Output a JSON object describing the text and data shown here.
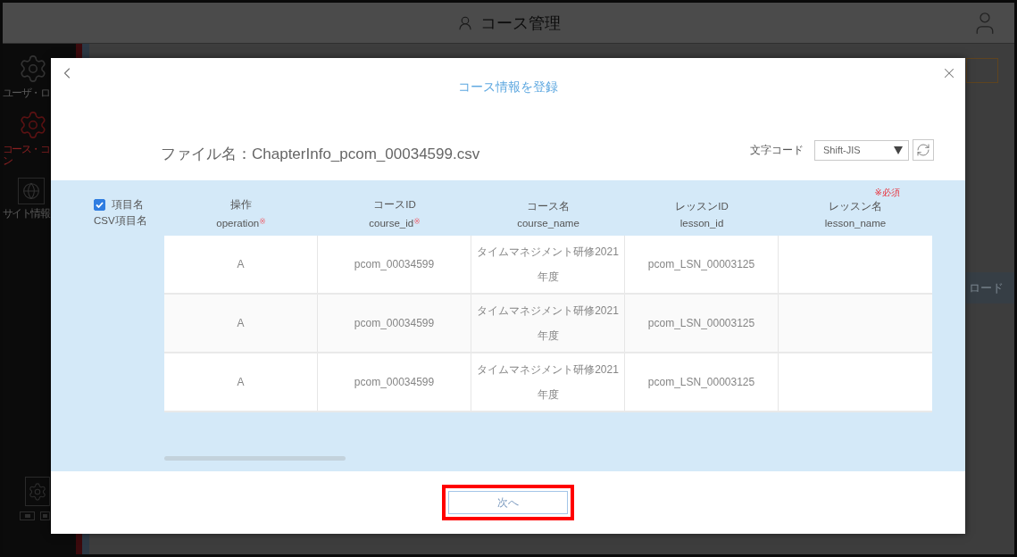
{
  "app_header": {
    "title": "コース管理"
  },
  "sidebar": {
    "items": [
      {
        "label": "ユーザ・ロ",
        "selected": false
      },
      {
        "label": "コース・コン",
        "selected": true
      },
      {
        "label": "サイト情報",
        "selected": false
      }
    ]
  },
  "background_tab": {
    "label": "ロード"
  },
  "dialog": {
    "title": "コース情報を登録",
    "file_name": "ファイル名：ChapterInfo_pcom_00034599.csv",
    "encoding": {
      "label": "文字コード",
      "value": "Shift-JIS"
    },
    "header_toggle": {
      "checked": true,
      "label": "項目名",
      "csv_label": "CSV項目名"
    },
    "table": {
      "columns": [
        {
          "name": "操作",
          "csv_name": "operation",
          "required_mark": "※"
        },
        {
          "name": "コースID",
          "csv_name": "course_id",
          "required_mark": "※"
        },
        {
          "name": "コース名",
          "csv_name": "course_name"
        },
        {
          "name": "レッスンID",
          "csv_name": "lesson_id"
        },
        {
          "name": "レッスン名",
          "csv_name": "lesson_name",
          "note": "※必須"
        }
      ],
      "rows": [
        {
          "cells": [
            "A",
            "pcom_00034599",
            "タイムマネジメント研修2021年度",
            "pcom_LSN_00003125"
          ]
        },
        {
          "cells": [
            "A",
            "pcom_00034599",
            "タイムマネジメント研修2021年度",
            "pcom_LSN_00003125"
          ]
        },
        {
          "cells": [
            "A",
            "pcom_00034599",
            "タイムマネジメント研修2021年度",
            "pcom_LSN_00003125"
          ]
        }
      ]
    },
    "next_button": {
      "label": "次へ",
      "highlighted": true
    }
  }
}
